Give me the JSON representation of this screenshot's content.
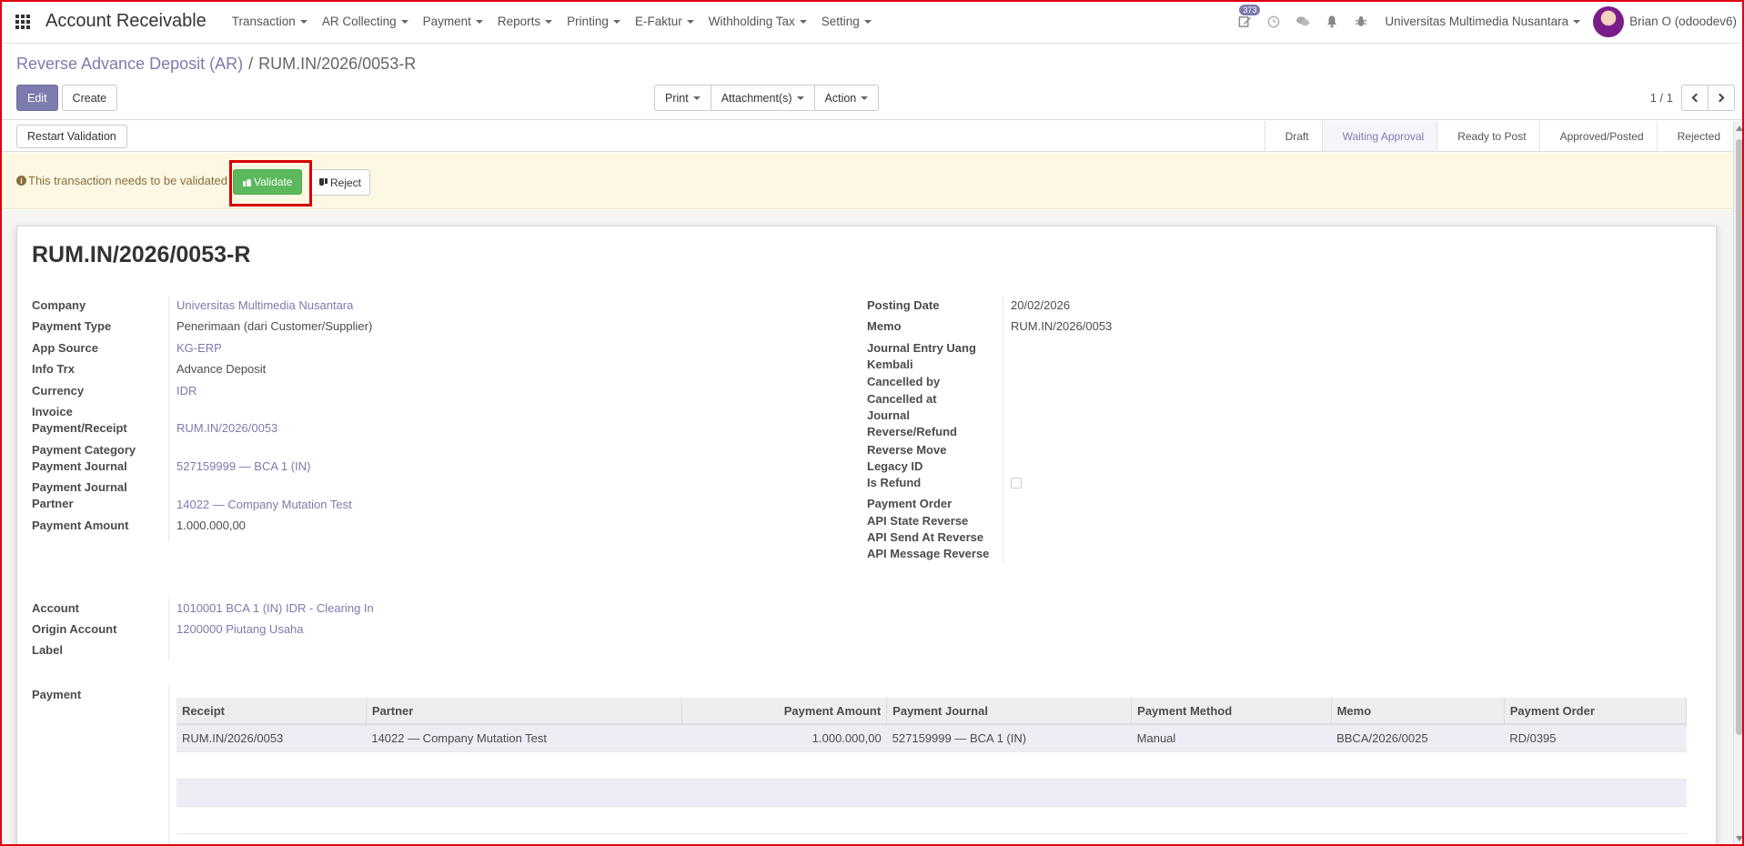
{
  "navbar": {
    "app_title": "Account Receivable",
    "menu": [
      {
        "label": "Transaction"
      },
      {
        "label": "AR Collecting"
      },
      {
        "label": "Payment"
      },
      {
        "label": "Reports"
      },
      {
        "label": "Printing"
      },
      {
        "label": "E-Faktur"
      },
      {
        "label": "Withholding Tax"
      },
      {
        "label": "Setting"
      }
    ],
    "activity_count": "373",
    "company": "Universitas Multimedia Nusantara",
    "user": "Brian O (odoodev6)"
  },
  "breadcrumb": {
    "parent": "Reverse Advance Deposit (AR)",
    "separator": "/",
    "current": "RUM.IN/2026/0053-R"
  },
  "toolbar": {
    "edit_label": "Edit",
    "create_label": "Create",
    "print_label": "Print",
    "attachments_label": "Attachment(s)",
    "action_label": "Action",
    "pager": "1 / 1"
  },
  "statusbar": {
    "restart_label": "Restart Validation",
    "stages": [
      "Draft",
      "Waiting Approval",
      "Ready to Post",
      "Approved/Posted",
      "Rejected"
    ],
    "current_stage": "Waiting Approval"
  },
  "validation": {
    "message": "This transaction needs to be validated",
    "validate_label": "Validate",
    "reject_label": "Reject"
  },
  "record": {
    "title": "RUM.IN/2026/0053-R",
    "left_fields": [
      {
        "label": "Company",
        "value": "Universitas Multimedia Nusantara"
      },
      {
        "label": "Payment Type",
        "value": "Penerimaan (dari Customer/Supplier)"
      },
      {
        "label": "App Source",
        "value": "KG-ERP"
      },
      {
        "label": "Info Trx",
        "value": "Advance Deposit"
      },
      {
        "label": "Currency",
        "value": "IDR"
      },
      {
        "label": "Invoice Payment/Receipt",
        "value": "RUM.IN/2026/0053"
      },
      {
        "label": "Payment Category",
        "value": ""
      },
      {
        "label": "Payment Journal",
        "value": "527159999 — BCA 1 (IN)"
      },
      {
        "label": "Payment Journal Partner",
        "value": "14022 — Company Mutation Test"
      },
      {
        "label": "Payment Amount",
        "value": "1.000.000,00"
      }
    ],
    "right_fields": [
      {
        "label": "Posting Date",
        "value": "20/02/2026"
      },
      {
        "label": "Memo",
        "value": "RUM.IN/2026/0053"
      },
      {
        "label": "Journal Entry Uang Kembali",
        "value": ""
      },
      {
        "label": "Cancelled by",
        "value": ""
      },
      {
        "label": "Cancelled at",
        "value": ""
      },
      {
        "label": "Journal Reverse/Refund",
        "value": ""
      },
      {
        "label": "Reverse Move",
        "value": ""
      },
      {
        "label": "Legacy ID",
        "value": ""
      },
      {
        "label": "Is Refund",
        "value": ""
      },
      {
        "label": "Payment Order",
        "value": ""
      },
      {
        "label": "API State Reverse",
        "value": ""
      },
      {
        "label": "API Send At Reverse",
        "value": ""
      },
      {
        "label": "API Message Reverse",
        "value": ""
      }
    ],
    "account_fields": [
      {
        "label": "Account",
        "value": "1010001 BCA 1 (IN) IDR - Clearing In"
      },
      {
        "label": "Origin Account",
        "value": "1200000 Piutang Usaha"
      },
      {
        "label": "Label",
        "value": ""
      }
    ],
    "payment_label": "Payment",
    "payment_table": {
      "columns": [
        "Receipt",
        "Partner",
        "Payment Amount",
        "Payment Journal",
        "Payment Method",
        "Memo",
        "Payment Order"
      ],
      "rows": [
        [
          "RUM.IN/2026/0053",
          "14022 — Company Mutation Test",
          "1.000.000,00",
          "527159999 — BCA 1 (IN)",
          "Manual",
          "BBCA/2026/0025",
          "RD/0395"
        ]
      ]
    }
  },
  "colors": {
    "primary": "#7c7bad",
    "validate": "#5cb85c",
    "alert_bg": "#fcf8e3",
    "highlight": "#d60000"
  }
}
